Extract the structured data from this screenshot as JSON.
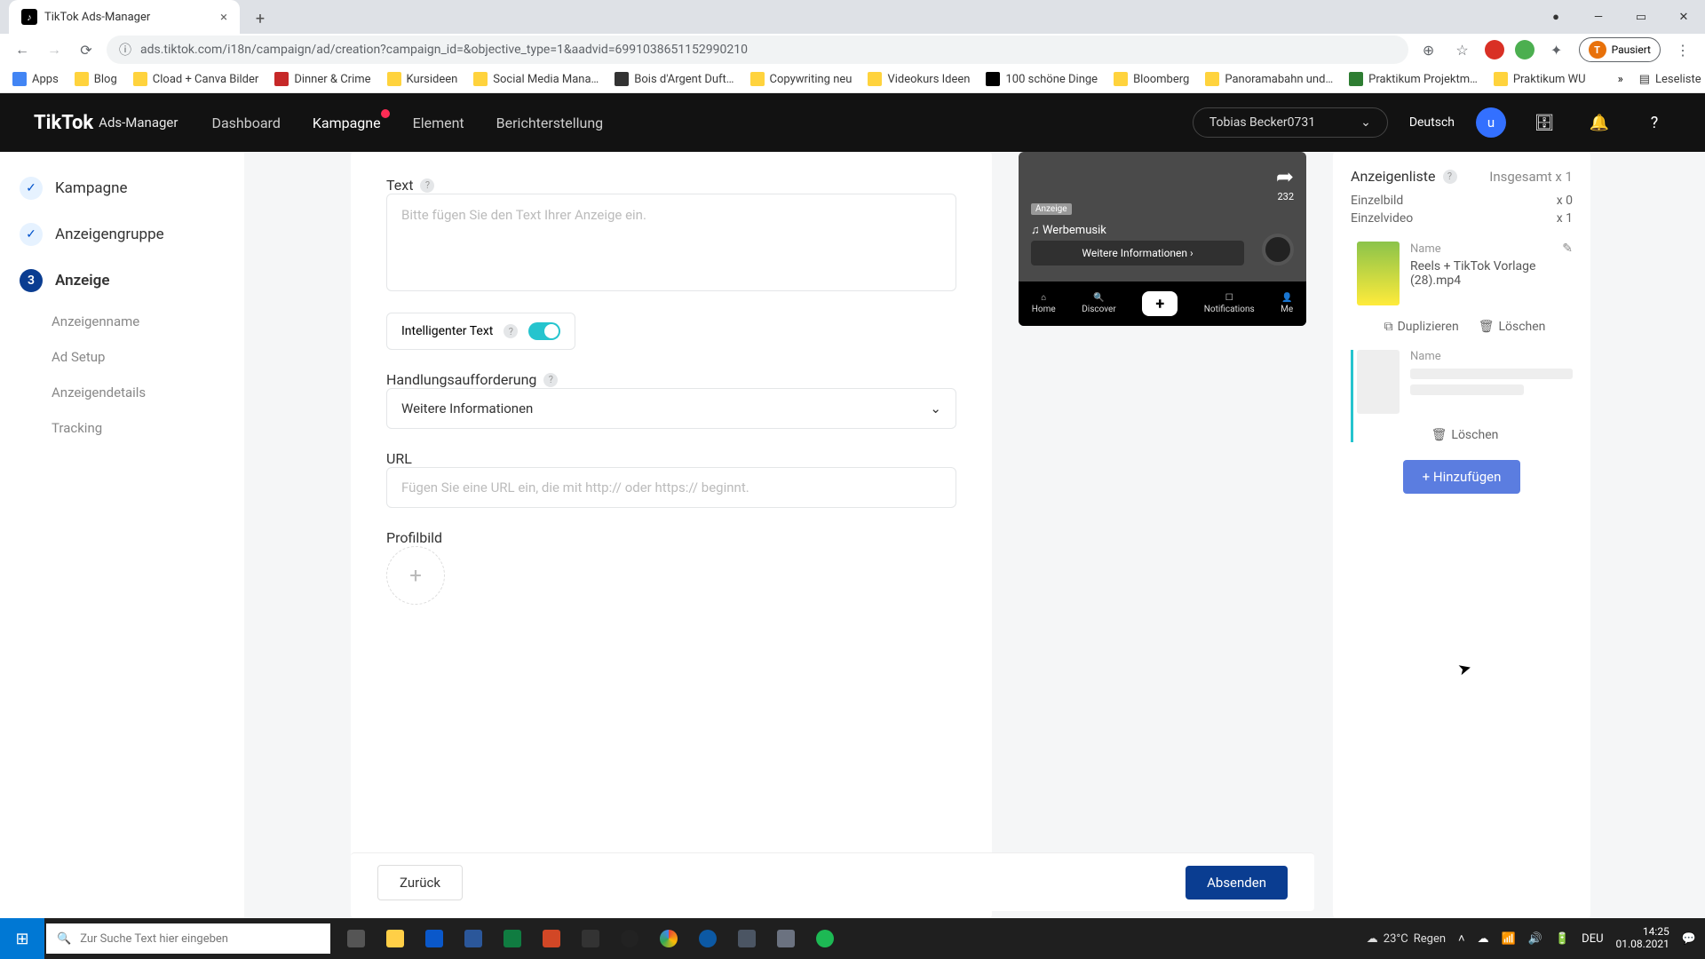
{
  "browser": {
    "tab_title": "TikTok Ads-Manager",
    "url": "ads.tiktok.com/i18n/campaign/ad/creation?campaign_id=&objective_type=1&aadvid=6991038651152990210",
    "pause_label": "Pausiert",
    "pause_initial": "T",
    "bookmarks": [
      "Apps",
      "Blog",
      "Cload + Canva Bilder",
      "Dinner & Crime",
      "Kursideen",
      "Social Media Mana…",
      "Bois d'Argent Duft…",
      "Copywriting neu",
      "Videokurs Ideen",
      "100 schöne Dinge",
      "Bloomberg",
      "Panoramabahn und…",
      "Praktikum Projektm…",
      "Praktikum WU"
    ],
    "reading_list": "Leseliste"
  },
  "header": {
    "brand": "TikTok",
    "brand_sub": "Ads-Manager",
    "nav": [
      "Dashboard",
      "Kampagne",
      "Element",
      "Berichterstellung"
    ],
    "account": "Tobias Becker0731",
    "language": "Deutsch",
    "avatar_initial": "u"
  },
  "steps": {
    "s1": "Kampagne",
    "s2": "Anzeigengruppe",
    "s3": "Anzeige",
    "s3_num": "3",
    "subs": [
      "Anzeigenname",
      "Ad Setup",
      "Anzeigendetails",
      "Tracking"
    ]
  },
  "form": {
    "text_label": "Text",
    "text_placeholder": "Bitte fügen Sie den Text Ihrer Anzeige ein.",
    "smart_text": "Intelligenter Text",
    "cta_label": "Handlungsaufforderung",
    "cta_value": "Weitere Informationen",
    "url_label": "URL",
    "url_placeholder": "Fügen Sie eine URL ein, die mit http:// oder https:// beginnt.",
    "profile_label": "Profilbild"
  },
  "preview": {
    "badge": "Anzeige",
    "music": "♫ Werbemusik",
    "cta": "Weitere Informationen ›",
    "share_count": "232",
    "nav": {
      "home": "Home",
      "discover": "Discover",
      "notif": "Notifications",
      "me": "Me"
    }
  },
  "right": {
    "title": "Anzeigenliste",
    "total_label": "Insgesamt x 1",
    "counts": [
      {
        "label": "Einzelbild",
        "value": "x 0"
      },
      {
        "label": "Einzelvideo",
        "value": "x 1"
      }
    ],
    "name_label": "Name",
    "ad1_name": "Reels + TikTok Vorlage (28).mp4",
    "duplicate": "Duplizieren",
    "delete": "Löschen",
    "add": "+ Hinzufügen"
  },
  "footer": {
    "back": "Zurück",
    "submit": "Absenden"
  },
  "taskbar": {
    "search_placeholder": "Zur Suche Text hier eingeben",
    "weather_temp": "23°C",
    "weather_cond": "Regen",
    "lang": "DEU",
    "time": "14:25",
    "date": "01.08.2021"
  }
}
